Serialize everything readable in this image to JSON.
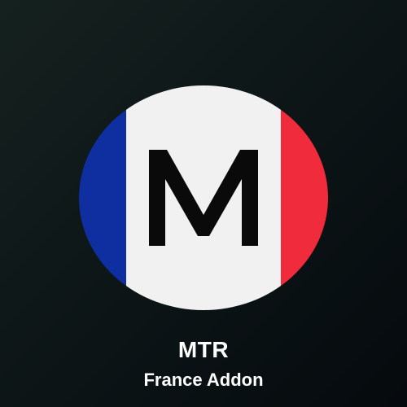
{
  "logo": {
    "letter": "M",
    "colors": {
      "blue": "#0f2fa0",
      "white": "#f1f1f1",
      "red": "#ef2b3c",
      "letter": "#0a0a0a"
    }
  },
  "app": {
    "name": "MTR",
    "subtitle": "France Addon"
  }
}
